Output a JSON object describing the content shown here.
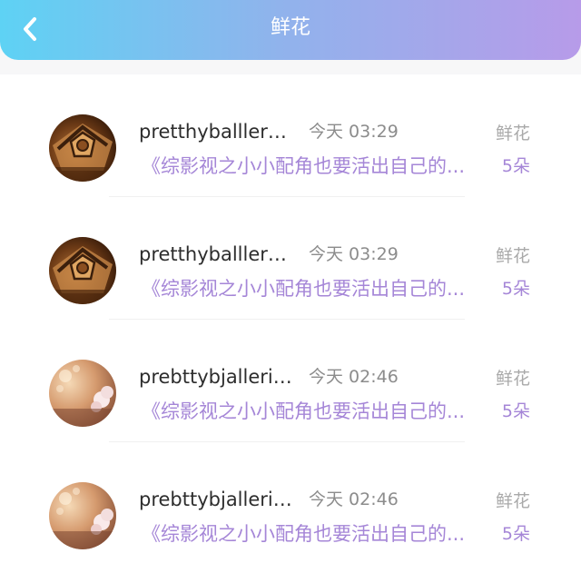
{
  "header": {
    "title": "鲜花",
    "back_icon": "chevron-left-icon",
    "gradient": [
      "#5ed2f4",
      "#90b3ec",
      "#b79be9"
    ]
  },
  "colors": {
    "accent": "#a586d7",
    "muted": "#8c8c8c",
    "text": "#2d2d2d"
  },
  "records": [
    {
      "user": "pretthyballlerfin...",
      "time": "今天 03:29",
      "gift": "鲜花",
      "book": "《综影视之小小配角也要活出自己的...",
      "count": "5朵",
      "avatar": "envelope-seal-avatar"
    },
    {
      "user": "pretthyballlerfin...",
      "time": "今天 03:29",
      "gift": "鲜花",
      "book": "《综影视之小小配角也要活出自己的...",
      "count": "5朵",
      "avatar": "envelope-seal-avatar"
    },
    {
      "user": "prebttybjallerin...",
      "time": "今天 02:46",
      "gift": "鲜花",
      "book": "《综影视之小小配角也要活出自己的...",
      "count": "5朵",
      "avatar": "sunset-flower-avatar"
    },
    {
      "user": "prebttybjallerin...",
      "time": "今天 02:46",
      "gift": "鲜花",
      "book": "《综影视之小小配角也要活出自己的...",
      "count": "5朵",
      "avatar": "sunset-flower-avatar"
    }
  ]
}
